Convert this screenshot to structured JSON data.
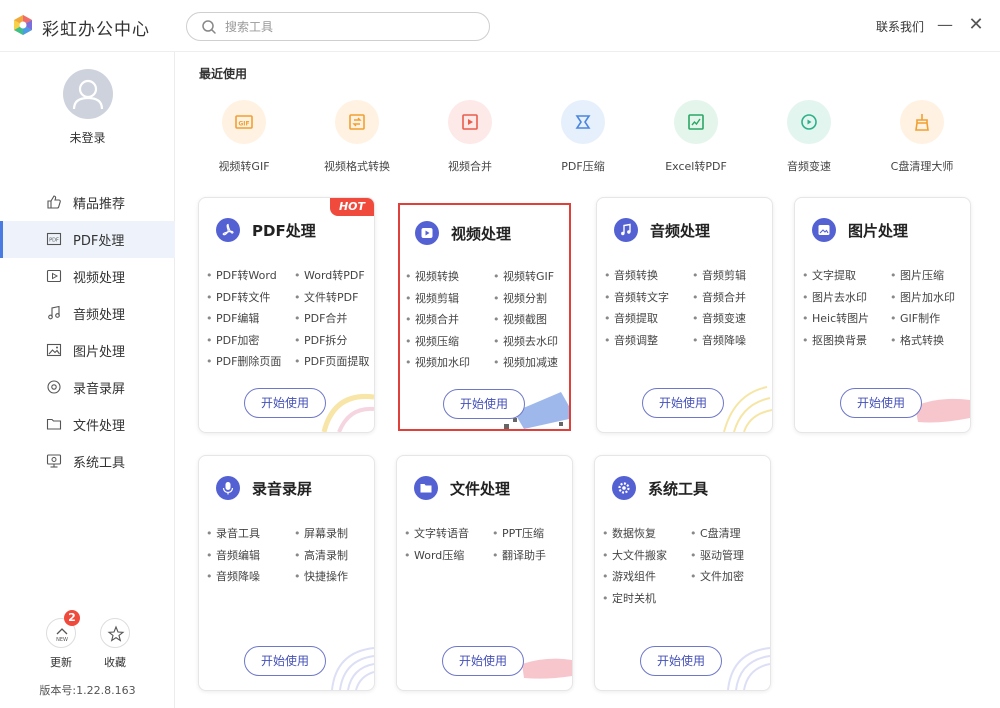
{
  "app": {
    "title": "彩虹办公中心"
  },
  "search": {
    "placeholder": "搜索工具"
  },
  "header": {
    "contact": "联系我们",
    "minimize": "—",
    "close": "✕"
  },
  "user": {
    "login_status": "未登录"
  },
  "sidebar": {
    "items": [
      {
        "label": "精品推荐",
        "icon": "thumbs-up-icon",
        "active": false
      },
      {
        "label": "PDF处理",
        "icon": "pdf-icon",
        "active": true
      },
      {
        "label": "视频处理",
        "icon": "video-play-icon",
        "active": false
      },
      {
        "label": "音频处理",
        "icon": "music-note-icon",
        "active": false
      },
      {
        "label": "图片处理",
        "icon": "image-icon",
        "active": false
      },
      {
        "label": "录音录屏",
        "icon": "record-icon",
        "active": false
      },
      {
        "label": "文件处理",
        "icon": "folder-icon",
        "active": false
      },
      {
        "label": "系统工具",
        "icon": "monitor-icon",
        "active": false
      }
    ],
    "update": {
      "label": "更新",
      "badge": "2",
      "icon_text": "NEW"
    },
    "favorites": {
      "label": "收藏"
    },
    "version": "版本号:1.22.8.163"
  },
  "recent": {
    "title": "最近使用",
    "items": [
      {
        "label": "视频转GIF",
        "icon": "gif-icon",
        "bg": "#fff2e3",
        "color": "#f0a030"
      },
      {
        "label": "视频格式转换",
        "icon": "convert-icon",
        "bg": "#fff2e3",
        "color": "#f0a030"
      },
      {
        "label": "视频合并",
        "icon": "merge-video-icon",
        "bg": "#fde9e7",
        "color": "#e95d4d"
      },
      {
        "label": "PDF压缩",
        "icon": "compress-icon",
        "bg": "#e6f0fd",
        "color": "#4a86e0"
      },
      {
        "label": "Excel转PDF",
        "icon": "excel-pdf-icon",
        "bg": "#e4f5ec",
        "color": "#2aa765"
      },
      {
        "label": "音频变速",
        "icon": "speed-icon",
        "bg": "#e2f5ef",
        "color": "#2db08a"
      },
      {
        "label": "C盘清理大师",
        "icon": "broom-icon",
        "bg": "#fff2e3",
        "color": "#f0a030"
      }
    ]
  },
  "cards": [
    {
      "title": "PDF处理",
      "icon": "pdf-icon",
      "hot": "HOT",
      "items": [
        "PDF转Word",
        "Word转PDF",
        "PDF转文件",
        "文件转PDF",
        "PDF编辑",
        "PDF合并",
        "PDF加密",
        "PDF拆分",
        "PDF删除页面",
        "PDF页面提取"
      ],
      "button": "开始使用"
    },
    {
      "title": "视频处理",
      "icon": "video-play-icon",
      "items": [
        "视频转换",
        "视频转GIF",
        "视频剪辑",
        "视频分割",
        "视频合并",
        "视频截图",
        "视频压缩",
        "视频去水印",
        "视频加水印",
        "视频加减速"
      ],
      "button": "开始使用"
    },
    {
      "title": "音频处理",
      "icon": "music-note-icon",
      "items": [
        "音频转换",
        "音频剪辑",
        "音频转文字",
        "音频合并",
        "音频提取",
        "音频变速",
        "音频调整",
        "音频降噪"
      ],
      "button": "开始使用"
    },
    {
      "title": "图片处理",
      "icon": "image-icon",
      "items": [
        "文字提取",
        "图片压缩",
        "图片去水印",
        "图片加水印",
        "Heic转图片",
        "GIF制作",
        "抠图换背景",
        "格式转换"
      ],
      "button": "开始使用"
    },
    {
      "title": "录音录屏",
      "icon": "microphone-icon",
      "items": [
        "录音工具",
        "屏幕录制",
        "音频编辑",
        "高清录制",
        "音频降噪",
        "快捷操作"
      ],
      "button": "开始使用"
    },
    {
      "title": "文件处理",
      "icon": "folder-icon",
      "items": [
        "文字转语音",
        "PPT压缩",
        "Word压缩",
        "翻译助手"
      ],
      "button": "开始使用"
    },
    {
      "title": "系统工具",
      "icon": "gear-icon",
      "items": [
        "数据恢复",
        "C盘清理",
        "大文件搬家",
        "驱动管理",
        "游戏组件",
        "文件加密",
        "定时关机"
      ],
      "button": "开始使用"
    }
  ],
  "colors": {
    "accent": "#5461d3",
    "active_bar": "#4a7be0",
    "hot": "#f04a3c",
    "highlight_border": "#e0403a"
  }
}
